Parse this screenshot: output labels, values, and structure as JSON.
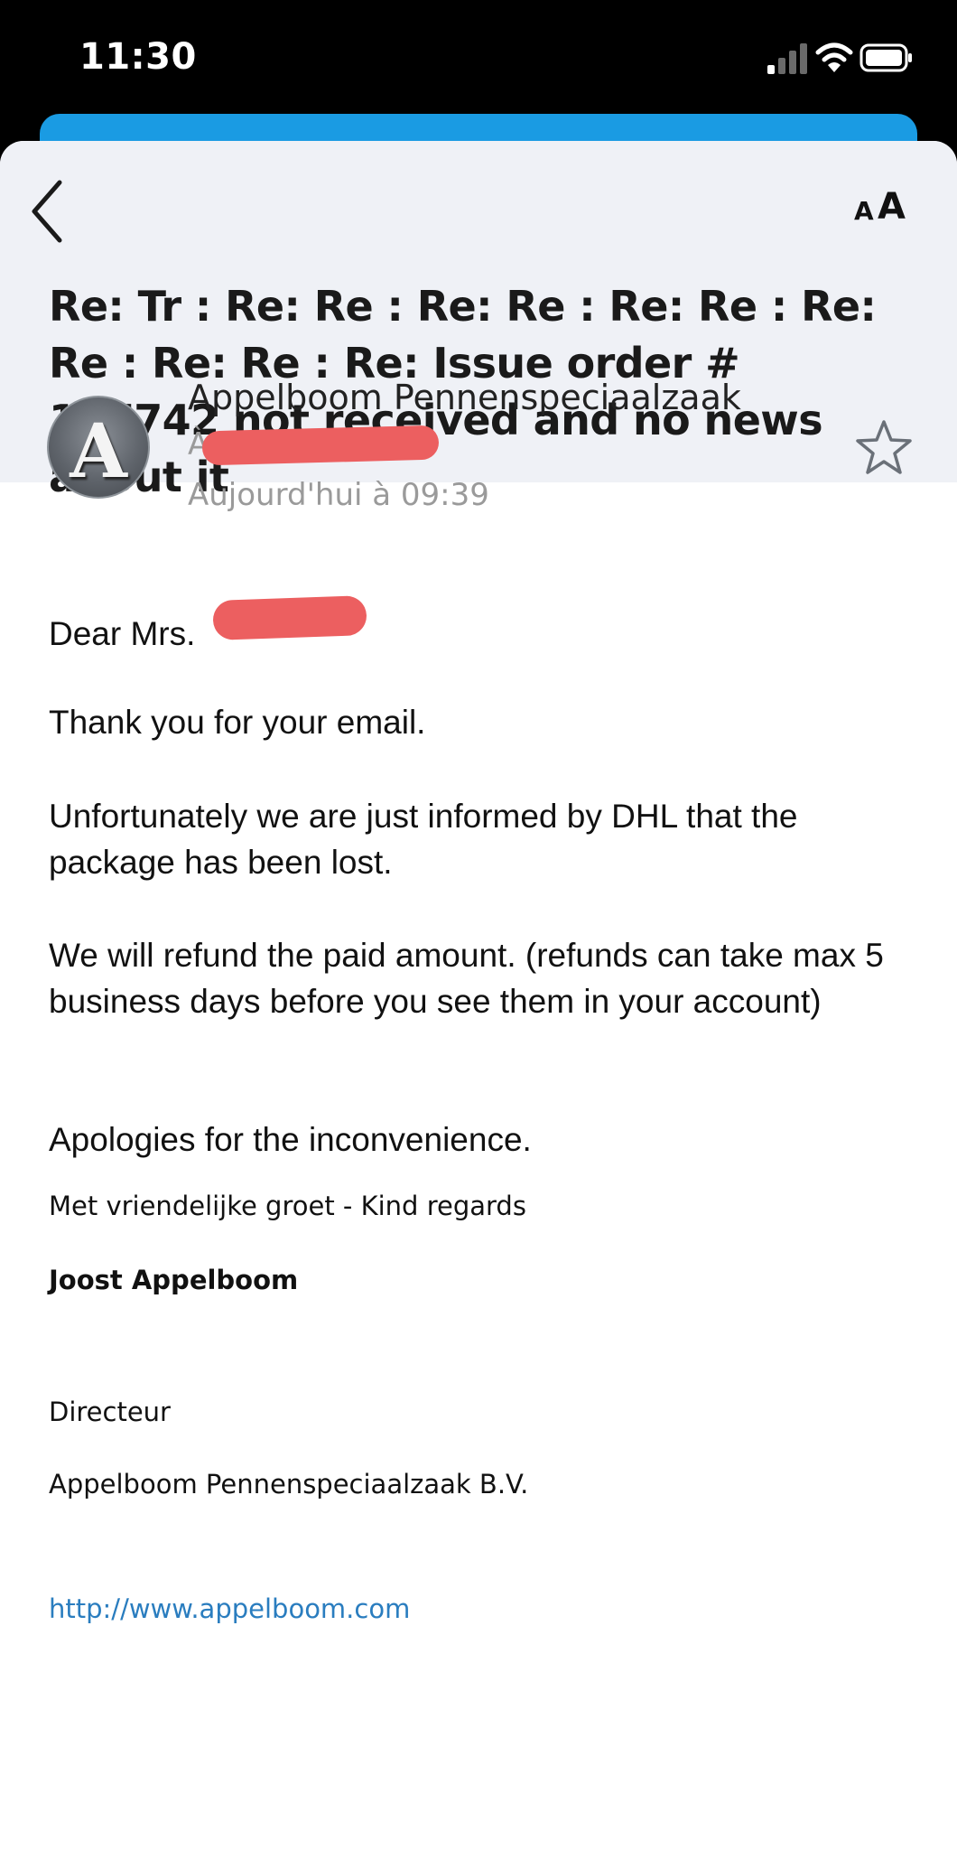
{
  "status_bar": {
    "time": "11:30",
    "icons": [
      "cellular-signal-icon",
      "wifi-icon",
      "battery-icon"
    ]
  },
  "header": {
    "back_icon": "chevron-left-icon",
    "text_size_label_small": "A",
    "text_size_label_big": "A",
    "subject": "Re: Tr : Re: Re : Re: Re : Re: Re : Re: Re : Re: Re : Re: Issue order # 157742 not received and no news about it"
  },
  "message": {
    "avatar_letter": "A",
    "sender_name": "Appelboom Pennenspeciaalzaak",
    "recipient_prefix": "À",
    "date": "Aujourd'hui à 09:39",
    "star_icon": "star-outline-icon"
  },
  "body": {
    "greeting": "Dear Mrs.",
    "paragraph_1": "Thank you for your email.",
    "paragraph_2": "Unfortunately we are just informed by DHL that the package has been lost.",
    "paragraph_3": "We will refund the paid amount. (refunds can take max 5 business days before you see them in your account)",
    "paragraph_4": "Apologies for the inconvenience."
  },
  "signature": {
    "regards": "Met vriendelijke groet - Kind regards",
    "name": "Joost Appelboom",
    "title": "Directeur",
    "company": "Appelboom Pennenspeciaalzaak B.V.",
    "link": "http://www.appelboom.com"
  },
  "colors": {
    "header_background": "#eff1f6",
    "accent_blue": "#1a9be3",
    "link_blue": "#2a7dbf",
    "redaction": "#ec5f60"
  }
}
